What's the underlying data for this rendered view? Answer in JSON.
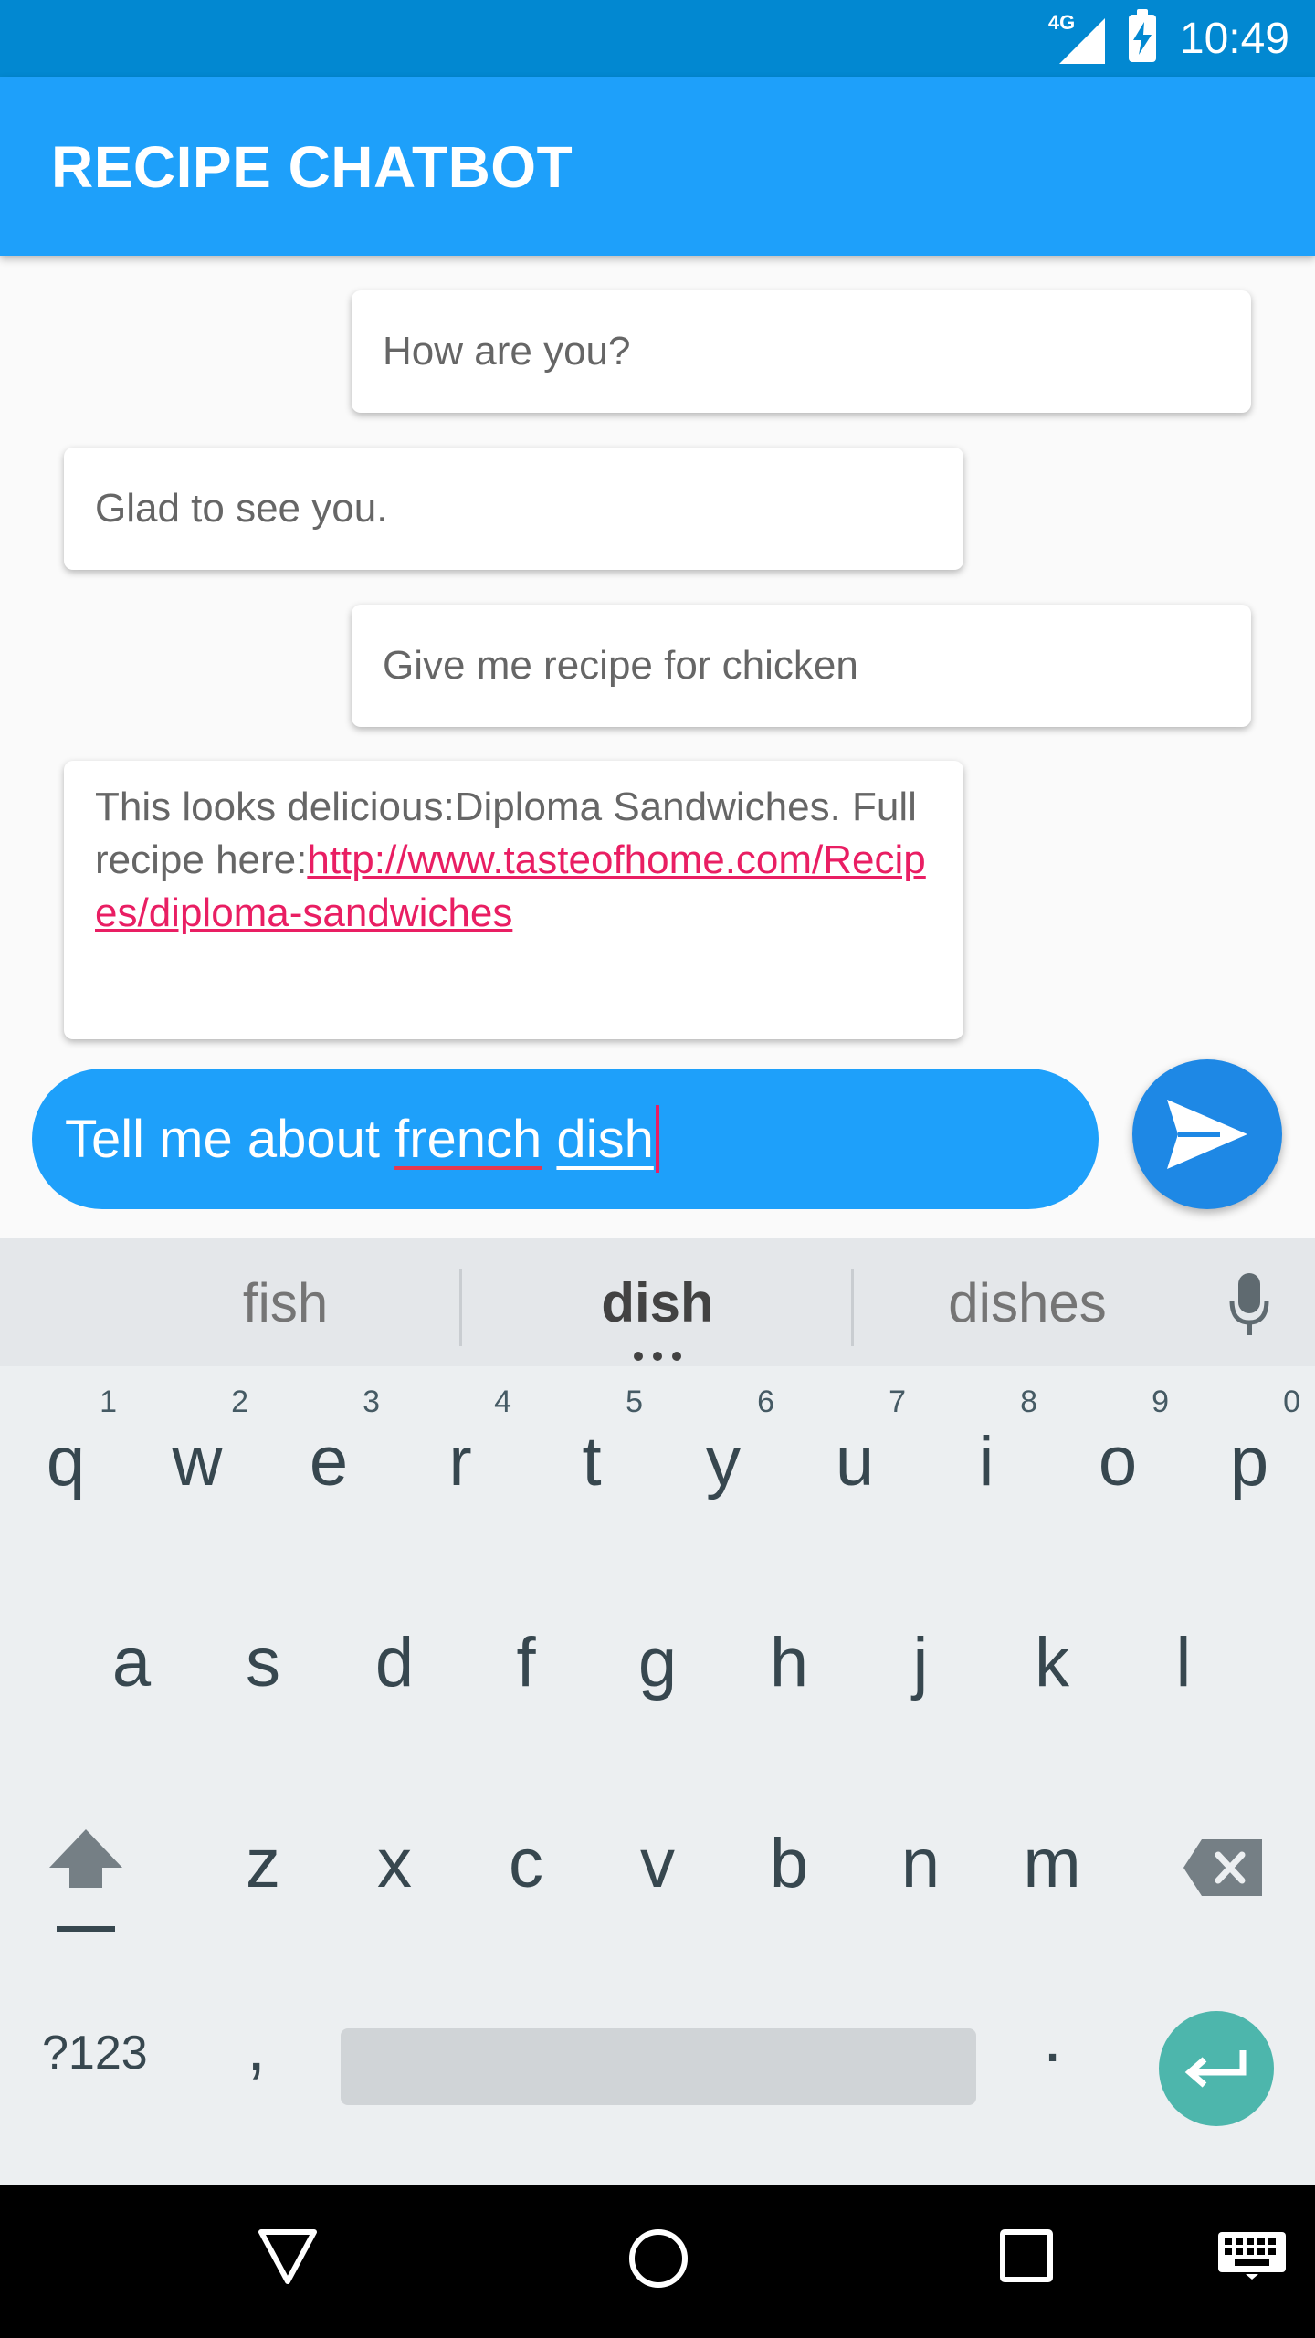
{
  "status_bar": {
    "network": "4G",
    "time": "10:49"
  },
  "app_bar": {
    "title": "RECIPE CHATBOT"
  },
  "messages": [
    {
      "from": "user",
      "text": "How are you?"
    },
    {
      "from": "bot",
      "text": "Glad to see you."
    },
    {
      "from": "user",
      "text": "Give me recipe for chicken"
    },
    {
      "from": "bot",
      "text": "This looks delicious:Diploma Sandwiches. Full recipe here:",
      "link": "http://www.tasteofhome.com/Recipes/diploma-sandwiches"
    }
  ],
  "input": {
    "part1": "Tell me about ",
    "word_misspelled": "french",
    "word_composing": "dish"
  },
  "suggestions": [
    "fish",
    "dish",
    "dishes"
  ],
  "keyboard": {
    "row1": [
      "q",
      "w",
      "e",
      "r",
      "t",
      "y",
      "u",
      "i",
      "o",
      "p"
    ],
    "row1_hints": [
      "1",
      "2",
      "3",
      "4",
      "5",
      "6",
      "7",
      "8",
      "9",
      "0"
    ],
    "row2": [
      "a",
      "s",
      "d",
      "f",
      "g",
      "h",
      "j",
      "k",
      "l"
    ],
    "row3": [
      "z",
      "x",
      "c",
      "v",
      "b",
      "n",
      "m"
    ],
    "symbols_label": "?123",
    "comma": ",",
    "period": "."
  },
  "colors": {
    "status": "#0288d1",
    "app_bar": "#1ea0fa",
    "send": "#1e88e5",
    "link": "#e91e63",
    "enter": "#4db6ac"
  },
  "icons": [
    "signal-4g-icon",
    "battery-charging-icon",
    "send-icon",
    "mic-icon",
    "shift-icon",
    "backspace-icon",
    "enter-icon",
    "back-icon",
    "home-icon",
    "recents-icon",
    "keyboard-icon"
  ]
}
